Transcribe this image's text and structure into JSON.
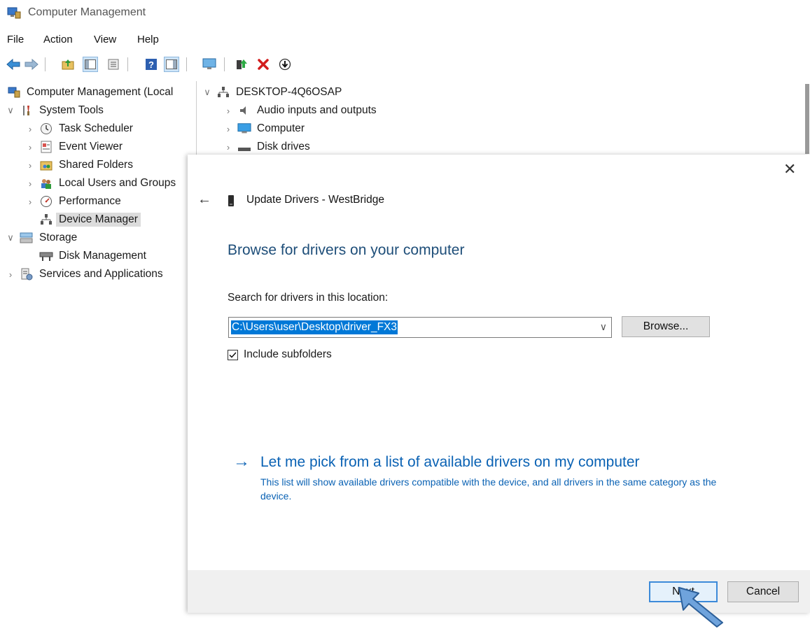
{
  "window": {
    "title": "Computer Management"
  },
  "menu": {
    "items": [
      "File",
      "Action",
      "View",
      "Help"
    ]
  },
  "toolbar": {
    "icons": [
      "back-icon",
      "forward-icon",
      "up-folder-icon",
      "show-hide-tree-icon",
      "properties-icon",
      "help-icon",
      "action-pane-icon",
      "monitor-icon",
      "update-driver-icon",
      "uninstall-icon",
      "scan-icon"
    ]
  },
  "left_tree": {
    "items": [
      {
        "label": "Computer Management (Local",
        "icon": "computer-management-icon"
      },
      {
        "label": "System Tools",
        "icon": "system-tools-icon"
      },
      {
        "label": "Task Scheduler",
        "icon": "clock-icon"
      },
      {
        "label": "Event Viewer",
        "icon": "event-viewer-icon"
      },
      {
        "label": "Shared Folders",
        "icon": "shared-folder-icon"
      },
      {
        "label": "Local Users and Groups",
        "icon": "users-icon"
      },
      {
        "label": "Performance",
        "icon": "performance-icon"
      },
      {
        "label": "Device Manager",
        "icon": "device-manager-icon"
      },
      {
        "label": "Storage",
        "icon": "storage-icon"
      },
      {
        "label": "Disk Management",
        "icon": "disk-management-icon"
      },
      {
        "label": "Services and Applications",
        "icon": "services-icon"
      }
    ]
  },
  "device_tree": {
    "root": "DESKTOP-4Q6OSAP",
    "items": [
      "Audio inputs and outputs",
      "Computer",
      "Disk drives"
    ]
  },
  "dialog": {
    "title": "Update Drivers - WestBridge",
    "heading": "Browse for drivers on your computer",
    "search_label": "Search for drivers in this location:",
    "location_value": "C:\\Users\\user\\Desktop\\driver_FX3",
    "browse_label": "Browse...",
    "include_subfolders_label": "Include subfolders",
    "include_subfolders_checked": true,
    "pick_title": "Let me pick from a list of available drivers on my computer",
    "pick_description": "This list will show available drivers compatible with the device, and all drivers in the same category as the device.",
    "next_label": "Next",
    "cancel_label": "Cancel"
  },
  "colors": {
    "accent": "#0a62b4",
    "heading": "#1e4e79",
    "selection": "#0078d7"
  }
}
